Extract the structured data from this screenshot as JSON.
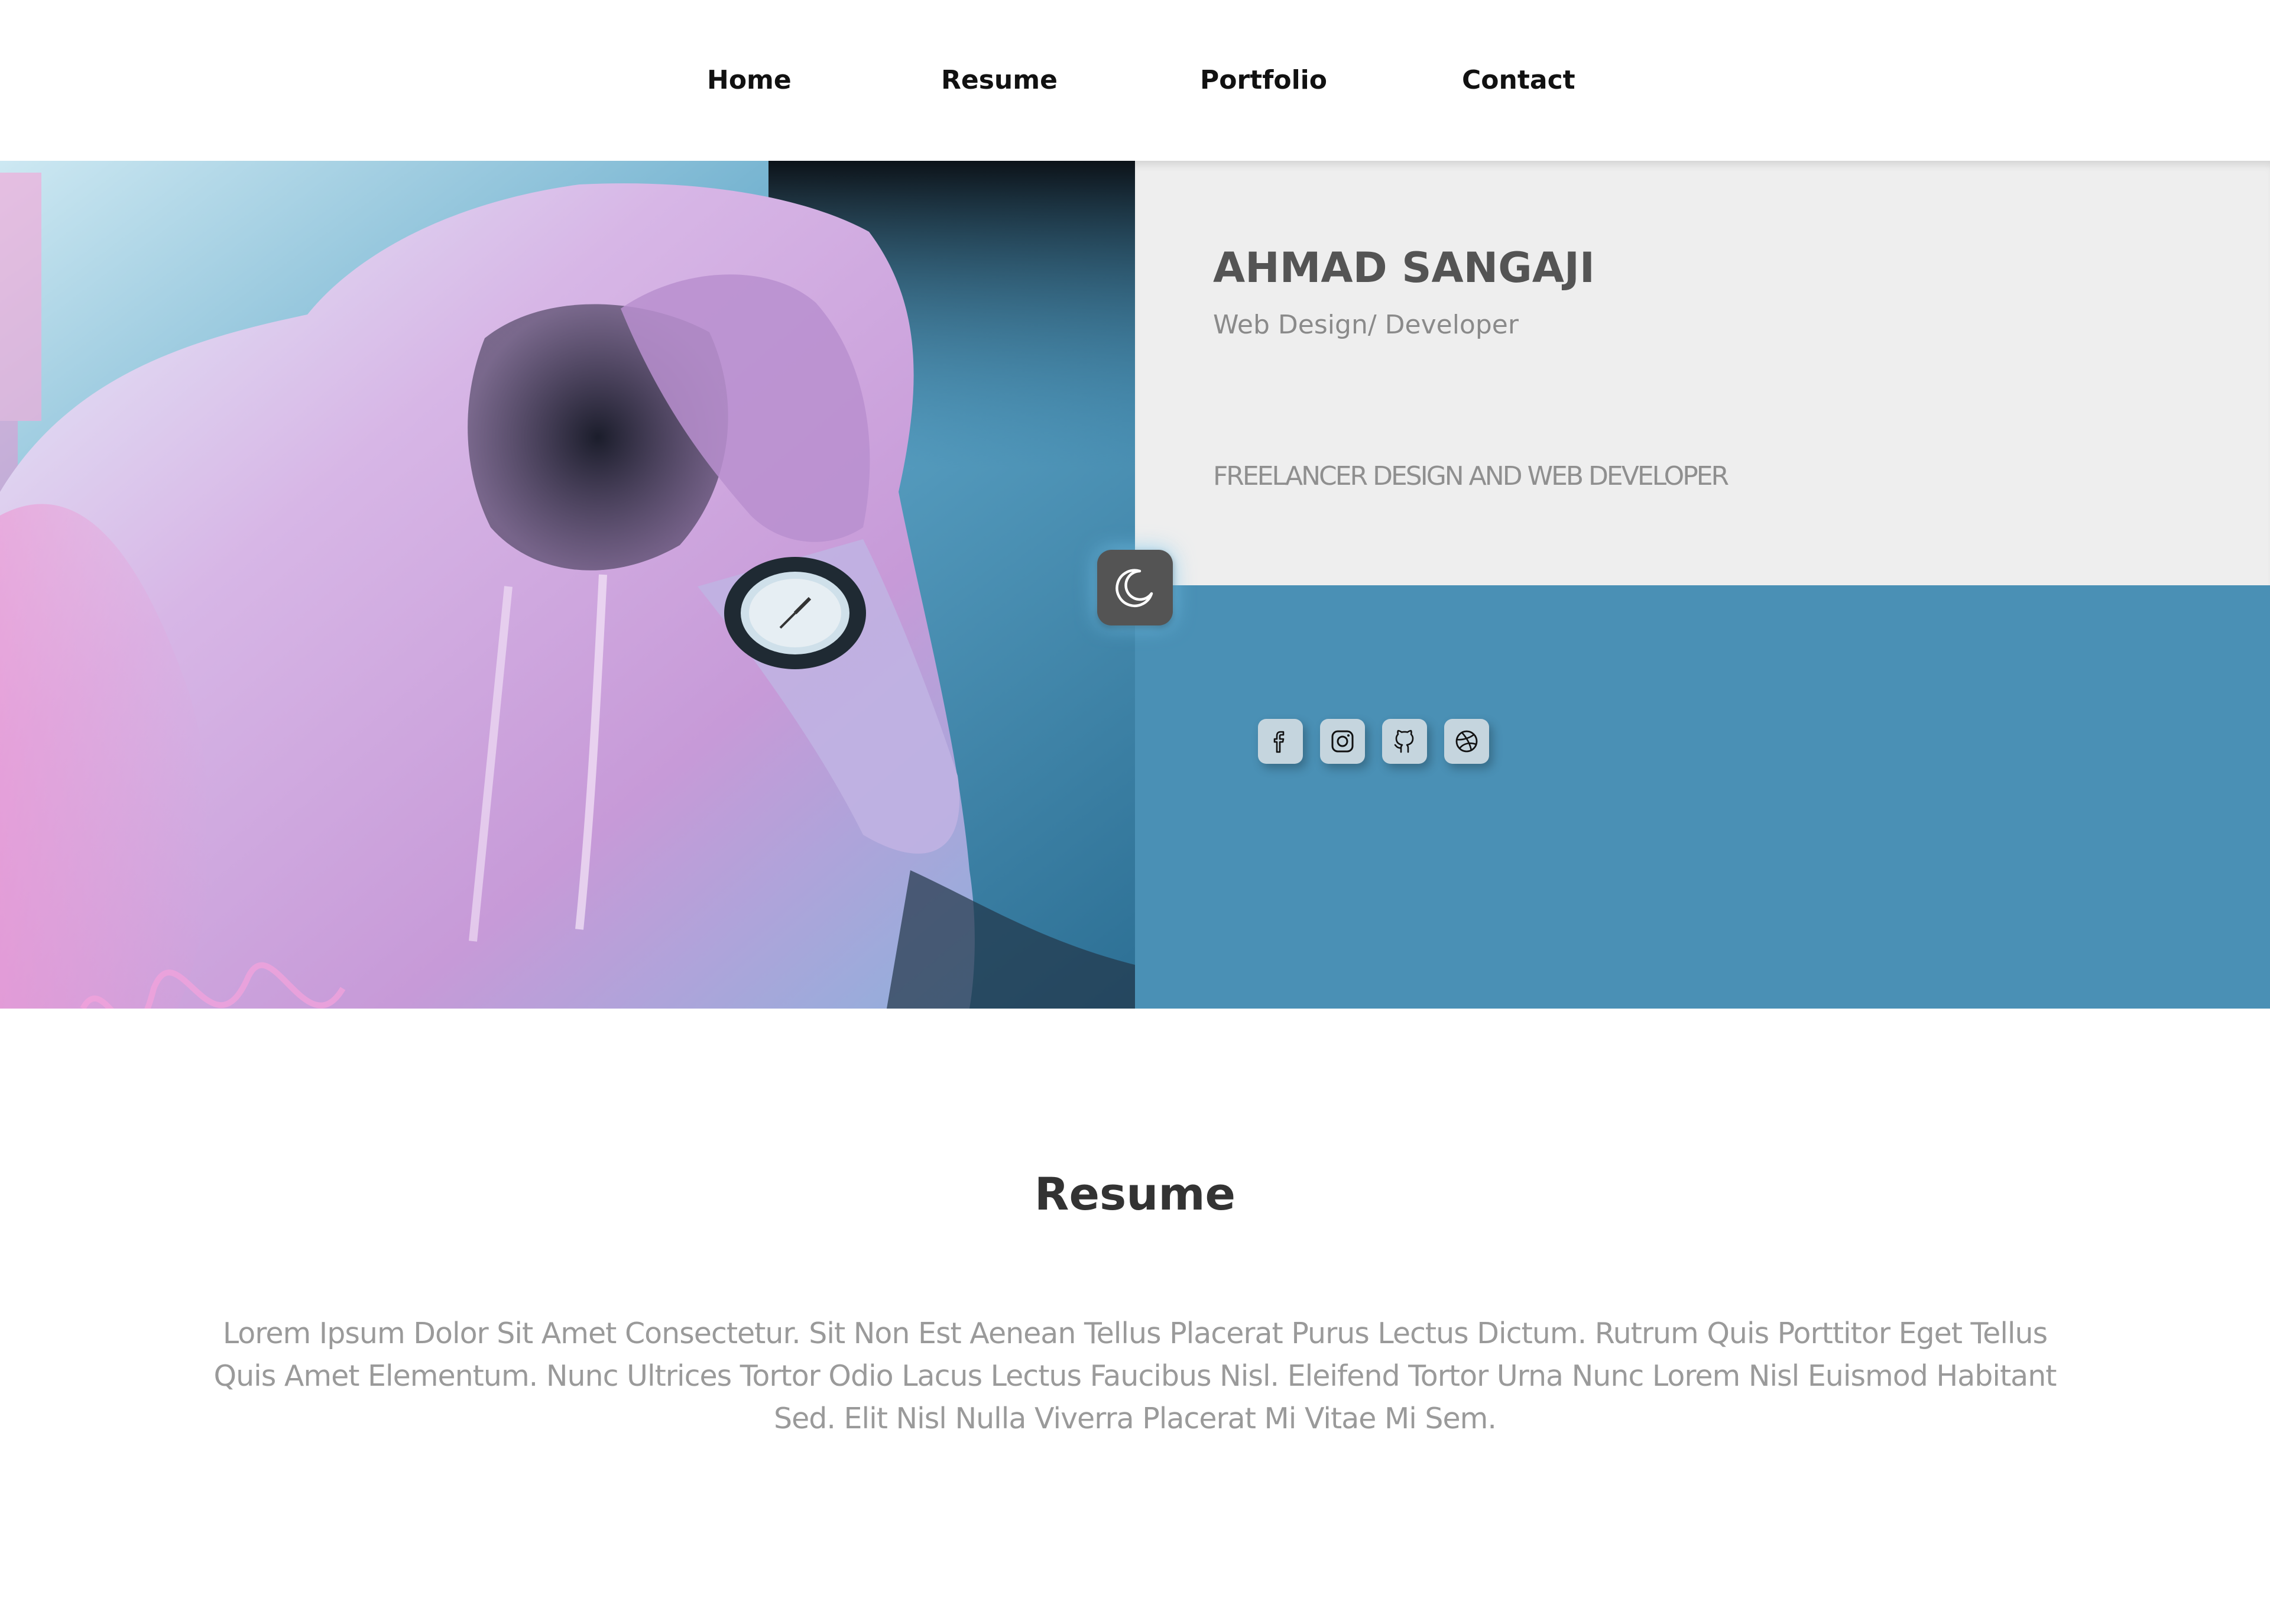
{
  "nav": {
    "items": [
      {
        "label": "Home"
      },
      {
        "label": "Resume"
      },
      {
        "label": "Portfolio"
      },
      {
        "label": "Contact"
      }
    ]
  },
  "profile": {
    "name": "AHMAD SANGAJI",
    "role": "Web Design/ Developer",
    "tagline": "FREELANCER DESIGN AND WEB DEVELOPER",
    "photo": "hooded person with watch"
  },
  "theme_toggle": {
    "icon": "moon-icon"
  },
  "socials": [
    {
      "icon": "facebook-icon"
    },
    {
      "icon": "instagram-icon"
    },
    {
      "icon": "github-icon"
    },
    {
      "icon": "dribbble-icon"
    }
  ],
  "resume": {
    "title": "Resume",
    "text": "Lorem Ipsum Dolor Sit Amet Consectetur. Sit Non Est Aenean Tellus Placerat Purus Lectus Dictum. Rutrum Quis Porttitor Eget Tellus Quis Amet Elementum. Nunc Ultrices Tortor Odio Lacus Lectus Faucibus Nisl. Eleifend Tortor Urna Nunc Lorem Nisl Euismod Habitant Sed. Elit Nisl Nulla Viverra Placerat Mi Vitae Mi Sem."
  },
  "colors": {
    "accent_blue": "#4a90b5",
    "panel_gray": "#eeeeee",
    "name_text": "#545454",
    "toggle_bg": "#545454",
    "social_bg": "#c5d5de"
  }
}
